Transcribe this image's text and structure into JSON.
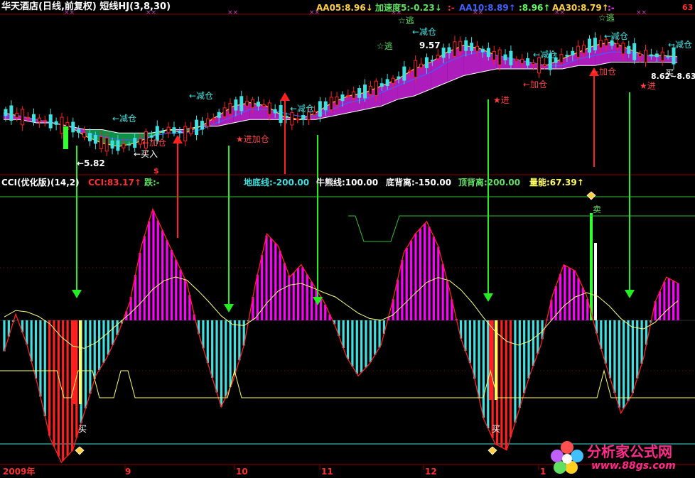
{
  "header": {
    "title": "华天酒店(日线,前复权) 短线HJ(3,8,30)",
    "aa05": "AA05:8.96↓",
    "accel": "加速度5:-0.23↓",
    "dash1": ":-",
    "aa10": "AA10:8.89↑",
    "aa10b": ":8.96↑",
    "aa30": "AA30:8.79↑",
    "dash2": ":-",
    "corner": "63"
  },
  "indicator_header": {
    "name": "CCI(优化版)(14,2)",
    "cci": "CCI:83.17↑",
    "die": "跌:-",
    "didi": "地底线:-200.00",
    "niuxiong": "牛熊线:100.00",
    "dibeili": "底背离:-150.00",
    "dingbeili": "顶背离:200.00",
    "liangneng": "量能:67.39↑"
  },
  "annotations": {
    "price_low": "←5.82",
    "price_high": "9.57",
    "price_right": "8.62~8.63",
    "jiancang": "←减仓",
    "jiacang": "←加仓",
    "mairu": "←买入",
    "jinjiacang": "★进加仓",
    "taoyi": "☆逃",
    "maisell": "卖",
    "mai": "买",
    "jin": "★进",
    "buy_right": "买",
    "s_mark": "$"
  },
  "x_axis": {
    "labels": [
      "2009年",
      "9",
      "10",
      "11",
      "12",
      "1"
    ]
  },
  "watermark": {
    "name": "分析家公式网",
    "url": "www.88gs.com"
  },
  "colors": {
    "background": "#000000",
    "grid_red": "#8b0000",
    "magenta": "#ff00ff",
    "cyan": "#40e0e0",
    "green": "#00dd00",
    "red": "#ff2020",
    "yellow": "#ffff60",
    "arrow_green": "#22ee22",
    "arrow_red": "#ff2020"
  },
  "chart_data": [
    {
      "type": "bar",
      "title": "华天酒店(日线,前复权) 短线HJ(3,8,30)",
      "series": [
        {
          "name": "AA05",
          "values": [
            7.3,
            7.2,
            7.1,
            7.0,
            6.9,
            6.6,
            6.4,
            6.3,
            6.4,
            6.6,
            6.8,
            6.7,
            6.9,
            7.2,
            7.5,
            7.6,
            7.5,
            7.2,
            7.1,
            7.3,
            7.6,
            7.8,
            7.9,
            8.1,
            8.3,
            8.6,
            8.8,
            9.1,
            9.3,
            9.2,
            9.0,
            8.9,
            8.8,
            8.7,
            8.9,
            9.1,
            9.3,
            9.4,
            9.2,
            9.0,
            9.0,
            8.96
          ]
        },
        {
          "name": "AA10",
          "values": [
            7.2,
            7.2,
            7.1,
            7.0,
            6.9,
            6.7,
            6.6,
            6.5,
            6.5,
            6.6,
            6.7,
            6.7,
            6.8,
            7.0,
            7.2,
            7.4,
            7.4,
            7.3,
            7.2,
            7.2,
            7.4,
            7.6,
            7.7,
            7.9,
            8.1,
            8.3,
            8.5,
            8.8,
            9.0,
            9.1,
            9.0,
            8.9,
            8.8,
            8.7,
            8.7,
            8.9,
            9.0,
            9.1,
            9.1,
            9.0,
            8.95,
            8.89
          ]
        },
        {
          "name": "AA30",
          "values": [
            7.1,
            7.1,
            7.0,
            7.0,
            6.9,
            6.8,
            6.8,
            6.7,
            6.7,
            6.7,
            6.8,
            6.8,
            6.9,
            6.9,
            7.0,
            7.1,
            7.1,
            7.1,
            7.1,
            7.1,
            7.2,
            7.3,
            7.4,
            7.5,
            7.7,
            7.8,
            8.0,
            8.2,
            8.4,
            8.5,
            8.6,
            8.6,
            8.6,
            8.6,
            8.6,
            8.7,
            8.7,
            8.8,
            8.8,
            8.8,
            8.8,
            8.79
          ]
        }
      ],
      "price_low": 5.82,
      "price_high": 9.57
    },
    {
      "type": "bar",
      "title": "CCI(优化版)(14,2)",
      "lines": {
        "didi": -200,
        "niuxiong": 100,
        "dibeili": -150,
        "dingbeili": 200
      },
      "ylim": [
        -250,
        250
      ],
      "cci": [
        -50,
        10,
        -40,
        -110,
        -190,
        -230,
        -210,
        -150,
        -90,
        -60,
        -20,
        30,
        120,
        180,
        140,
        100,
        60,
        -20,
        -80,
        -140,
        -100,
        -40,
        60,
        140,
        120,
        70,
        90,
        60,
        30,
        -10,
        -60,
        -90,
        -70,
        -40,
        30,
        110,
        140,
        160,
        120,
        50,
        -30,
        -80,
        -160,
        -200,
        -210,
        -150,
        -90,
        -40,
        40,
        90,
        80,
        40,
        -30,
        -90,
        -150,
        -120,
        -60,
        30,
        70,
        60
      ]
    }
  ]
}
